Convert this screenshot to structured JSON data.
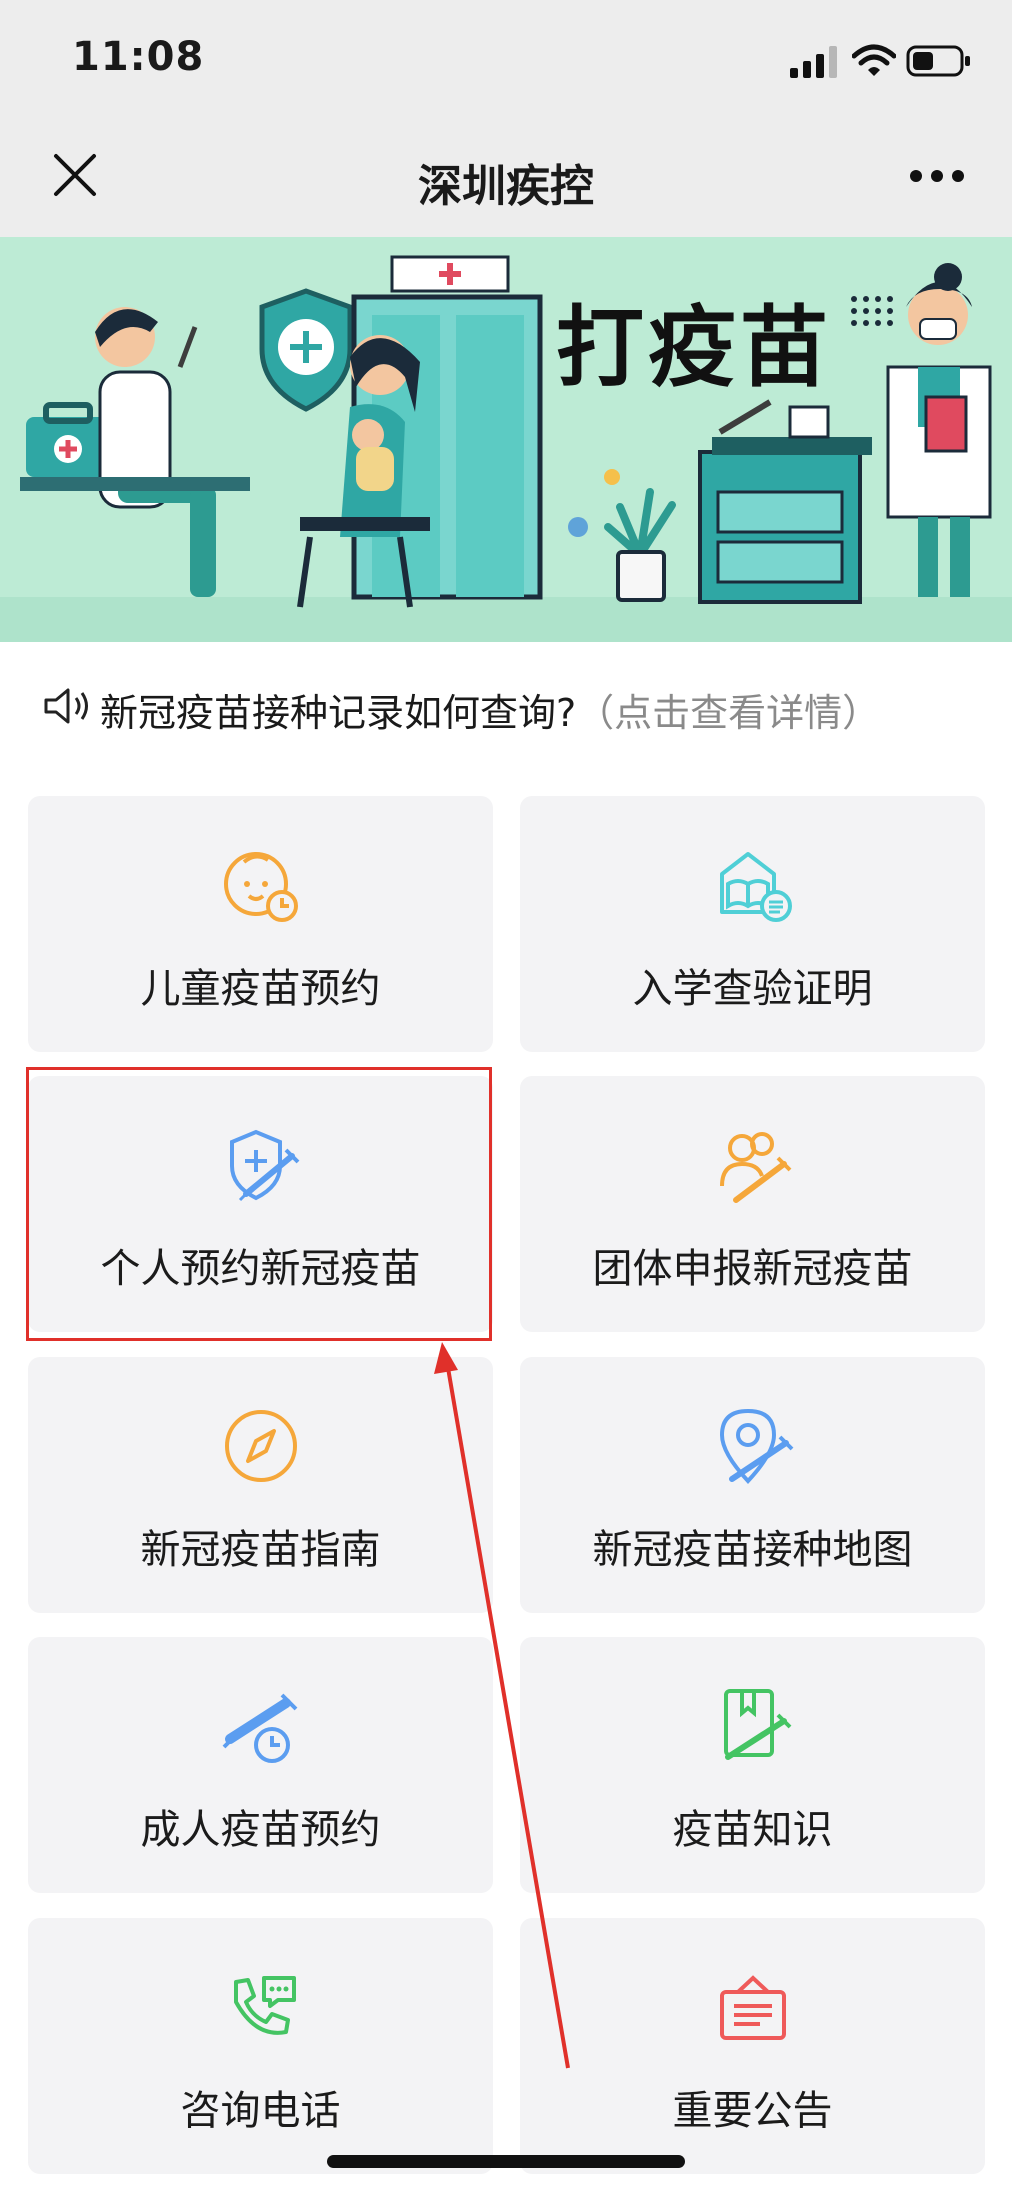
{
  "status_bar": {
    "time": "11:08"
  },
  "nav": {
    "title": "深圳疾控"
  },
  "banner": {
    "title": "打疫苗"
  },
  "notice": {
    "text": "新冠疫苗接种记录如何查询?",
    "hint": "（点击查看详情）"
  },
  "grid": {
    "items": [
      {
        "label": "儿童疫苗预约",
        "icon": "baby-clock-icon",
        "color": "#f5a73a"
      },
      {
        "label": "入学查验证明",
        "icon": "book-house-icon",
        "color": "#4fcfd6"
      },
      {
        "label": "个人预约新冠疫苗",
        "icon": "shield-syringe-icon",
        "color": "#5b9df0"
      },
      {
        "label": "团体申报新冠疫苗",
        "icon": "group-syringe-icon",
        "color": "#f5a73a"
      },
      {
        "label": "新冠疫苗指南",
        "icon": "compass-icon",
        "color": "#f5a73a"
      },
      {
        "label": "新冠疫苗接种地图",
        "icon": "map-pin-syringe-icon",
        "color": "#5b9df0"
      },
      {
        "label": "成人疫苗预约",
        "icon": "syringe-clock-icon",
        "color": "#5b9df0"
      },
      {
        "label": "疫苗知识",
        "icon": "book-syringe-icon",
        "color": "#44c463"
      },
      {
        "label": "咨询电话",
        "icon": "phone-chat-icon",
        "color": "#44c463"
      },
      {
        "label": "重要公告",
        "icon": "notice-board-icon",
        "color": "#ef5a5a"
      }
    ]
  }
}
